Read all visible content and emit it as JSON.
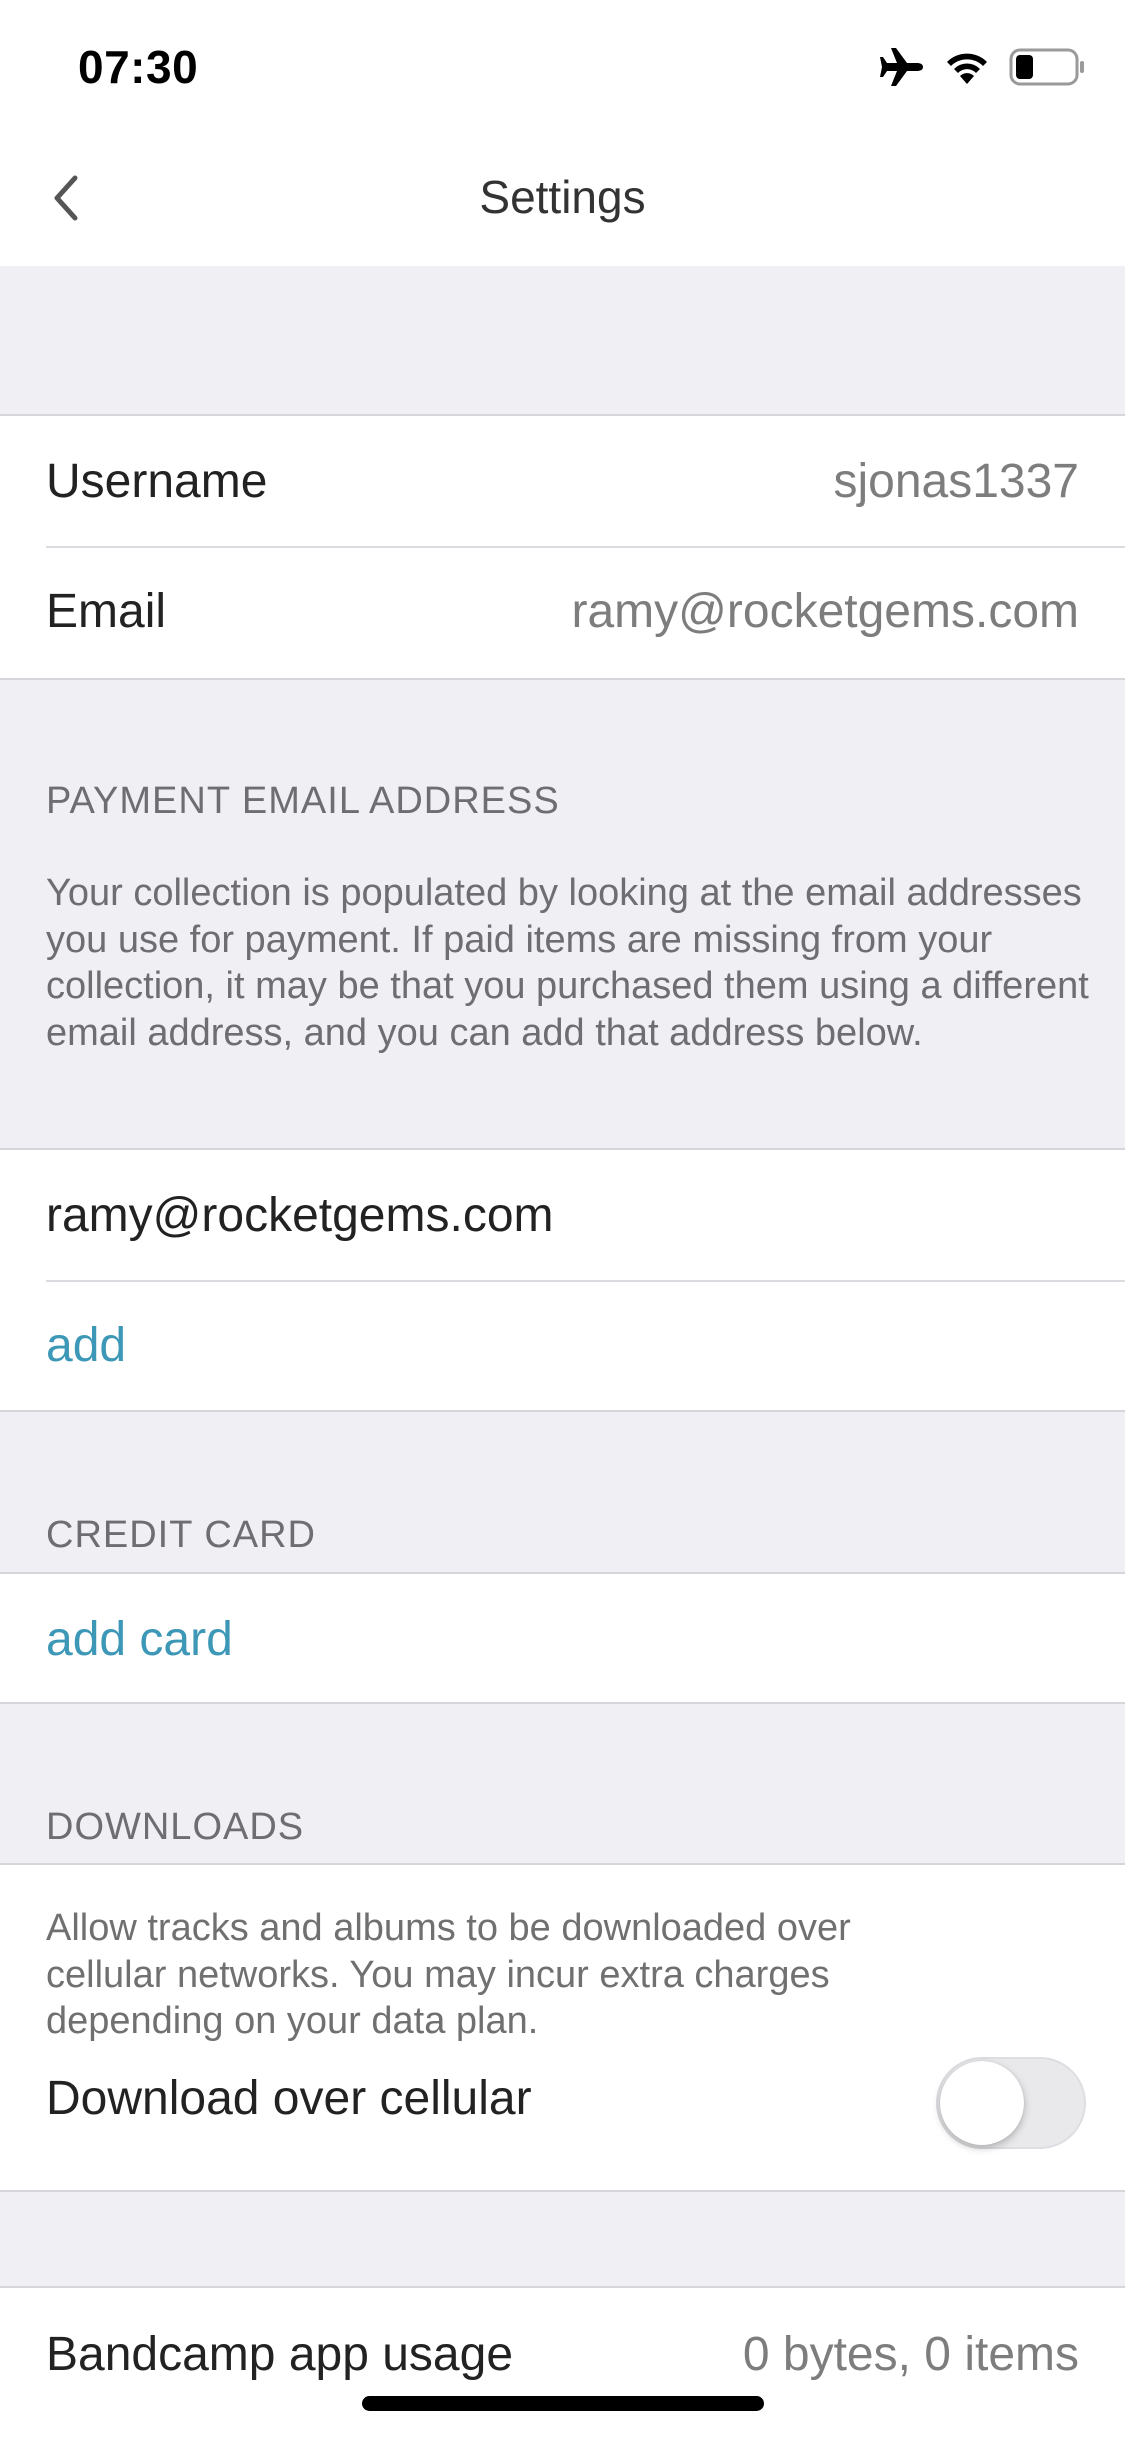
{
  "status_bar": {
    "time": "07:30",
    "icons": [
      "airplane-mode-icon",
      "wifi-icon",
      "battery-icon"
    ],
    "battery_level": 0.3
  },
  "nav": {
    "back_icon": "chevron-left-icon",
    "title": "Settings"
  },
  "account": {
    "username_label": "Username",
    "username_value": "sjonas1337",
    "email_label": "Email",
    "email_value": "ramy@rocketgems.com"
  },
  "payment_email": {
    "header": "PAYMENT EMAIL ADDRESS",
    "description": "Your collection is populated by looking at the email addresses you use for payment. If paid items are missing from your collection, it may be that you purchased them using a different email address, and you can add that address below.",
    "emails": [
      "ramy@rocketgems.com"
    ],
    "add_label": "add"
  },
  "credit_card": {
    "header": "CREDIT CARD",
    "add_label": "add card"
  },
  "downloads": {
    "header": "DOWNLOADS",
    "description": "Allow tracks and albums to be downloaded over cellular networks. You may incur extra charges depending on your data plan.",
    "toggle_label": "Download over cellular",
    "toggle_on": false
  },
  "usage": {
    "label": "Bandcamp app usage",
    "value": "0 bytes, 0 items"
  },
  "colors": {
    "accent": "#3d97b7",
    "background": "#efeff4",
    "cell": "#ffffff",
    "secondary_text": "#6d6d72"
  }
}
